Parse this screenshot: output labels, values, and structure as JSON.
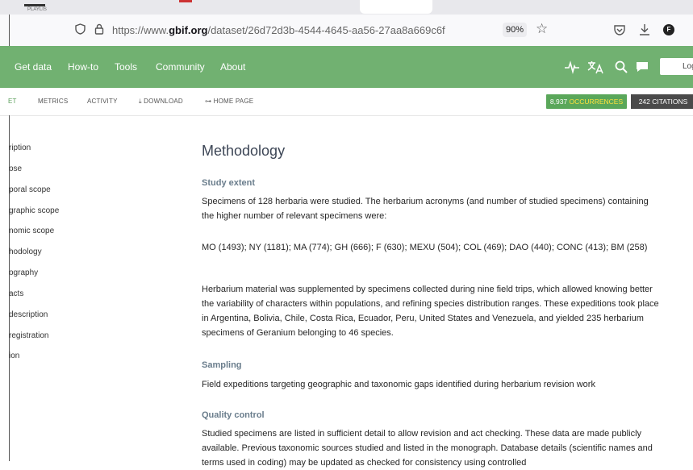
{
  "browser": {
    "tab_text": "PLAYLIS",
    "url_prefix": "https://www.",
    "url_domain": "gbif.org",
    "url_path": "/dataset/26d72d3b-4544-4645-aa56-27aa8a669c6f",
    "zoom": "90%",
    "profile_letter": "F"
  },
  "site_nav": {
    "items": [
      "Get data",
      "How-to",
      "Tools",
      "Community",
      "About"
    ],
    "login": "Log"
  },
  "sub_nav": {
    "items": [
      "ET",
      "METRICS",
      "ACTIVITY",
      "DOWNLOAD",
      "HOME PAGE"
    ],
    "occurrences_count": "8,937",
    "occurrences_label": "OCCURRENCES",
    "citations": "242 CITATIONS"
  },
  "sidebar": {
    "items": [
      "ription",
      "ose",
      "poral scope",
      "graphic scope",
      "nomic scope",
      "hodology",
      "ography",
      "acts",
      "description",
      "registration",
      "ion"
    ]
  },
  "content": {
    "title": "Methodology",
    "sections": [
      {
        "heading": "Study extent",
        "paragraphs": [
          "Specimens of 128 herbaria were studied. The herbarium acronyms (and number of studied specimens) containing the higher number of relevant specimens were:",
          "MO (1493); NY (1181); MA (774); GH (666); F (630); MEXU (504); COL (469); DAO (440); CONC (413); BM (258)",
          "Herbarium material was supplemented by specimens collected during nine field trips, which allowed knowing better the variability of characters within populations, and refining species distribution ranges. These expeditions took place in Argentina, Bolivia, Chile, Costa Rica, Ecuador, Peru, United States and Venezuela, and yielded 235 herbarium specimens of Geranium belonging to 46 species."
        ]
      },
      {
        "heading": "Sampling",
        "paragraphs": [
          "Field expeditions targeting geographic and taxonomic gaps identified during herbarium revision work"
        ]
      },
      {
        "heading": "Quality control",
        "paragraphs": [
          "Studied specimens are listed in sufficient detail to allow revision and act checking. These data are made publicly available. Previous taxonomic sources studied and listed in the monograph. Database details (scientific names and terms used in coding) may be updated as checked for consistency using controlled"
        ]
      }
    ]
  },
  "colors": {
    "gbif_green": "#71b171",
    "occurrence_badge": "#5aa75a",
    "citation_badge": "#4a4a4a",
    "heading": "#6a7d8c"
  },
  "icons": [
    "shield-icon",
    "lock-icon",
    "star-icon",
    "pocket-icon",
    "download-icon",
    "profile-icon",
    "activity-icon",
    "translate-icon",
    "search-icon",
    "chat-icon"
  ]
}
